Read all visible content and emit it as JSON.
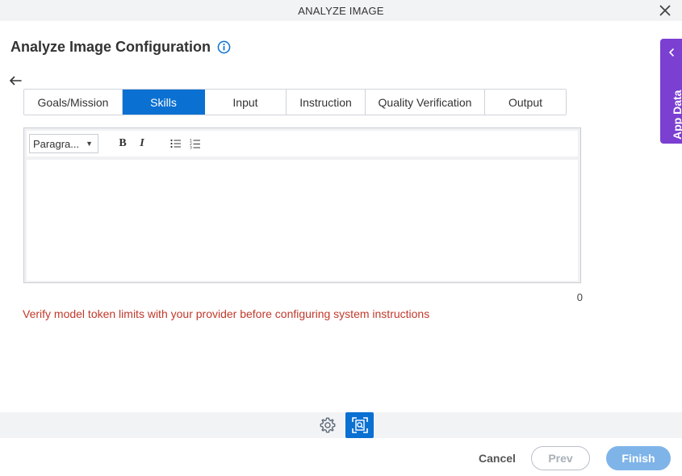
{
  "window": {
    "title": "ANALYZE IMAGE",
    "close_icon": "close-icon"
  },
  "header": {
    "title": "Analyze Image Configuration",
    "info_icon": "info-icon"
  },
  "back_icon": "arrow-left-icon",
  "tabs": [
    {
      "label": "Goals/Mission",
      "active": false
    },
    {
      "label": "Skills",
      "active": true
    },
    {
      "label": "Input",
      "active": false
    },
    {
      "label": "Instruction",
      "active": false
    },
    {
      "label": "Quality Verification",
      "active": false
    },
    {
      "label": "Output",
      "active": false
    }
  ],
  "editor": {
    "paragraph_select": "Paragra...",
    "bold_label": "B",
    "italic_label": "I",
    "bullet_list_icon": "bullet-list-icon",
    "numbered_list_icon": "numbered-list-icon",
    "content": "",
    "char_count": "0"
  },
  "warning": "Verify model token limits with your provider before configuring system instructions",
  "app_data": {
    "label": "App Data",
    "icon": "chevron-left-icon"
  },
  "bottom_bar": {
    "settings_icon": "gear-icon",
    "ai_icon": "image-analyze-icon"
  },
  "footer": {
    "cancel": "Cancel",
    "prev": "Prev",
    "finish": "Finish"
  },
  "colors": {
    "accent": "#0a70d2",
    "app_data_bg": "#7b3fd1",
    "warning_text": "#c0392b",
    "finish_bg": "#7fb4e8"
  }
}
